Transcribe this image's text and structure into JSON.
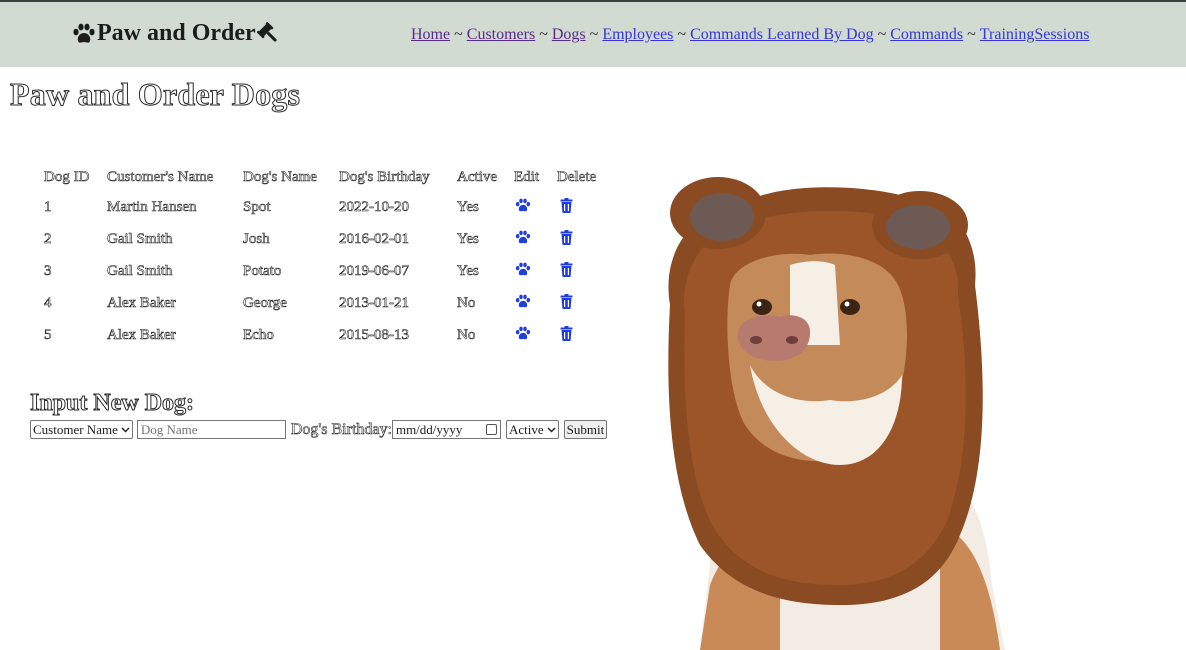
{
  "header": {
    "brand": "Paw and Order",
    "nav": [
      {
        "label": "Home",
        "visited": true
      },
      {
        "label": "Customers",
        "visited": true
      },
      {
        "label": "Dogs",
        "visited": true
      },
      {
        "label": "Employees",
        "visited": false
      },
      {
        "label": "Commands Learned By Dog",
        "visited": false
      },
      {
        "label": "Commands",
        "visited": false
      },
      {
        "label": "TrainingSessions",
        "visited": false
      }
    ],
    "separators": [
      "~",
      "~",
      "~",
      "~",
      "~",
      "~"
    ],
    "background_color": "#d1dbd2",
    "link_color": "#3535d8",
    "visited_link_color": "#5a2a8a"
  },
  "page": {
    "title": "Paw and Order Dogs"
  },
  "table": {
    "headers": [
      "Dog ID",
      "Customer's Name",
      "Dog's Name",
      "Dog's Birthday",
      "Active",
      "Edit",
      "Delete"
    ],
    "rows": [
      {
        "id": "1",
        "customer": "Martin Hansen",
        "dog": "Spot",
        "birthday": "2022-10-20",
        "active": "Yes"
      },
      {
        "id": "2",
        "customer": "Gail Smith",
        "dog": "Josh",
        "birthday": "2016-02-01",
        "active": "Yes"
      },
      {
        "id": "3",
        "customer": "Gail Smith",
        "dog": "Potato",
        "birthday": "2019-06-07",
        "active": "Yes"
      },
      {
        "id": "4",
        "customer": "Alex Baker",
        "dog": "George",
        "birthday": "2013-01-21",
        "active": "No"
      },
      {
        "id": "5",
        "customer": "Alex Baker",
        "dog": "Echo",
        "birthday": "2015-08-13",
        "active": "No"
      }
    ],
    "edit_icon": "paw-icon",
    "delete_icon": "trash-icon",
    "icon_color": "#1f3ee0"
  },
  "form": {
    "heading": "Input New Dog:",
    "customer_select": "Customer Name",
    "dog_name_placeholder": "Dog Name",
    "birthday_label": "Dog's Birthday:",
    "date_placeholder": "mm/dd/yyyy",
    "active_select": "Active",
    "submit_label": "Submit"
  }
}
